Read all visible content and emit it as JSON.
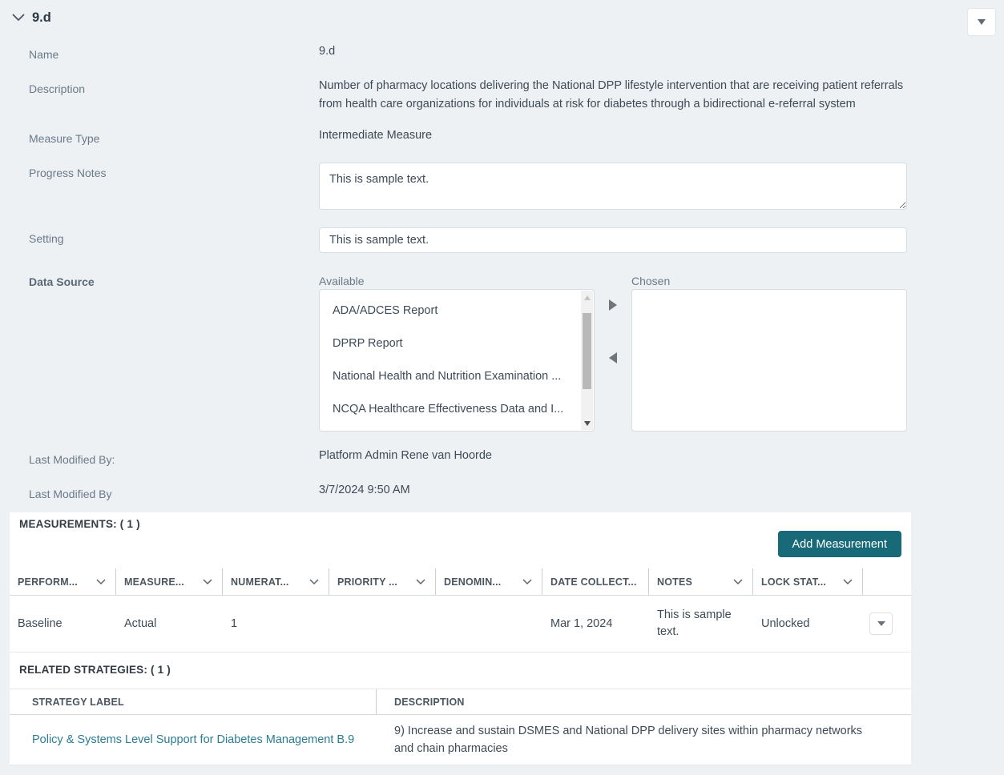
{
  "app": {
    "section_title": "9.d"
  },
  "form": {
    "name": {
      "label": "Name",
      "value": "9.d"
    },
    "description": {
      "label": "Description",
      "value": "Number of pharmacy locations delivering the National DPP lifestyle intervention that are receiving patient referrals from health care organizations for individuals at risk for diabetes through a bidirectional e-referral system"
    },
    "measure_type": {
      "label": "Measure Type",
      "value": "Intermediate Measure"
    },
    "progress_notes": {
      "label": "Progress Notes",
      "value": "This is sample text."
    },
    "setting": {
      "label": "Setting",
      "value": "This is sample text."
    },
    "data_source": {
      "label": "Data Source",
      "available_label": "Available",
      "chosen_label": "Chosen",
      "available_items": [
        "ADA/ADCES Report",
        "DPRP Report",
        "National Health and Nutrition Examination ...",
        "NCQA Healthcare Effectiveness Data and I..."
      ],
      "chosen_items": []
    },
    "last_modified_by": {
      "label": "Last Modified By:",
      "value": "Platform Admin Rene van Hoorde"
    },
    "last_modified_date": {
      "label": "Last Modified By",
      "value": "3/7/2024 9:50 AM"
    }
  },
  "measurements": {
    "title": "MEASUREMENTS: ( 1 )",
    "add_button": "Add Measurement",
    "columns": [
      {
        "label": "PERFORM..."
      },
      {
        "label": "MEASURE..."
      },
      {
        "label": "NUMERAT..."
      },
      {
        "label": "PRIORITY ..."
      },
      {
        "label": "DENOMIN..."
      },
      {
        "label": "DATE COLLECT..."
      },
      {
        "label": "NOTES"
      },
      {
        "label": "LOCK STAT..."
      }
    ],
    "row": {
      "performance": "Baseline",
      "measure": "Actual",
      "numerator": "1",
      "priority": "",
      "denominator": "",
      "date_collected": "Mar 1, 2024",
      "notes": "This is sample text.",
      "lock_status": "Unlocked"
    }
  },
  "related_strategies": {
    "title": "RELATED STRATEGIES: ( 1 )",
    "columns": {
      "label": "STRATEGY LABEL",
      "description": "DESCRIPTION"
    },
    "row": {
      "label": "Policy & Systems Level Support for Diabetes Management B.9",
      "description": "9) Increase and sustain DSMES and National DPP delivery sites within pharmacy networks and chain pharmacies"
    }
  },
  "colors": {
    "page_bg": "#EDF1F4",
    "accent_teal": "#186A79",
    "link_teal": "#2A7D92"
  }
}
